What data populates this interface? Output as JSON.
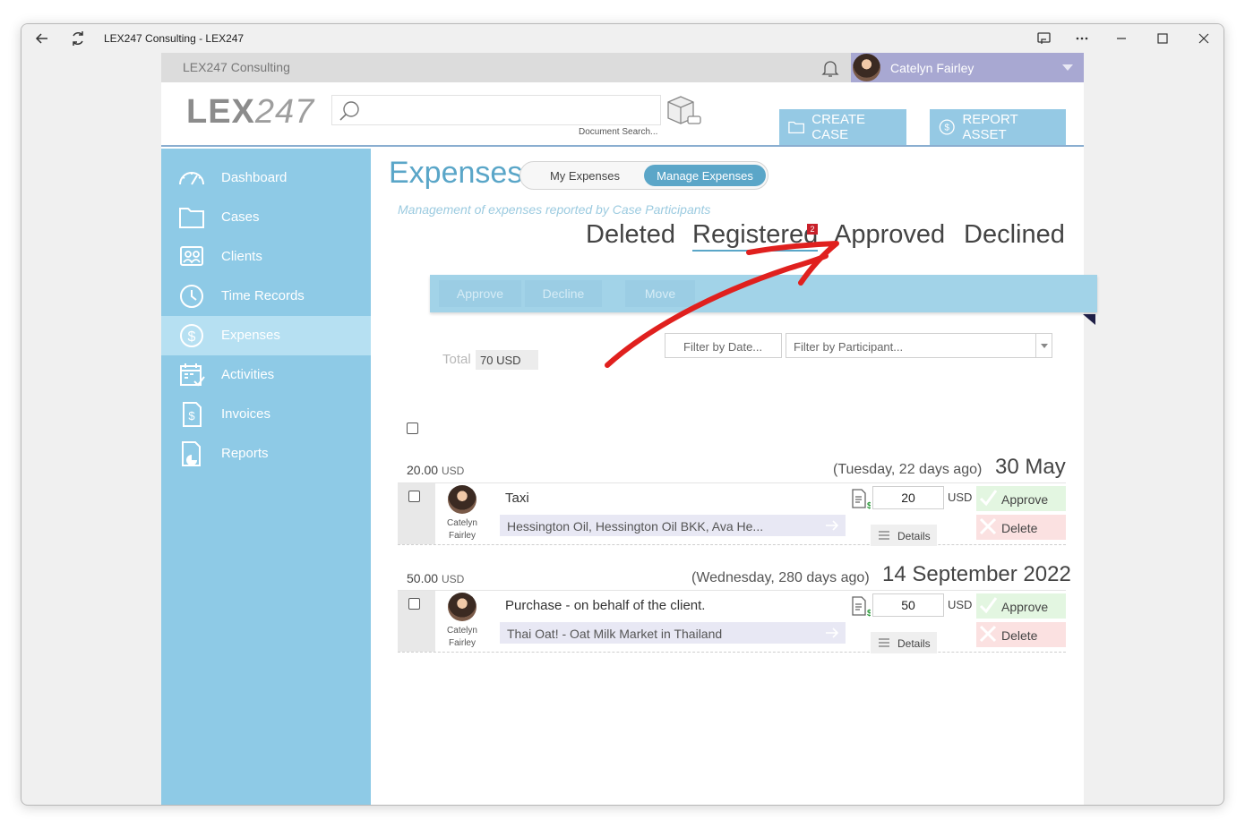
{
  "window": {
    "title": "LEX247 Consulting - LEX247"
  },
  "topbar": {
    "org_name": "LEX247 Consulting",
    "user_name": "Catelyn Fairley"
  },
  "header": {
    "logo_bold": "LEX",
    "logo_light": "247",
    "search_placeholder": "",
    "doc_search_label": "Document Search...",
    "create_case_label": "CREATE CASE",
    "report_asset_label": "REPORT ASSET"
  },
  "sidebar": {
    "items": [
      {
        "label": "Dashboard",
        "icon": "speedometer-icon"
      },
      {
        "label": "Cases",
        "icon": "folder-icon"
      },
      {
        "label": "Clients",
        "icon": "clients-icon"
      },
      {
        "label": "Time Records",
        "icon": "clock-icon"
      },
      {
        "label": "Expenses",
        "icon": "dollar-circle-icon",
        "active": true
      },
      {
        "label": "Activities",
        "icon": "calendar-check-icon"
      },
      {
        "label": "Invoices",
        "icon": "invoice-icon"
      },
      {
        "label": "Reports",
        "icon": "report-icon"
      }
    ]
  },
  "page": {
    "title": "Expenses",
    "toggle": {
      "my": "My Expenses",
      "manage": "Manage Expenses",
      "selected": "Manage Expenses"
    },
    "subtitle": "Management of expenses reported by Case Participants",
    "status_tabs": [
      "Deleted",
      "Registered",
      "Approved",
      "Declined"
    ],
    "active_tab": "Registered",
    "registered_badge": "2",
    "actions": {
      "approve": "Approve",
      "decline": "Decline",
      "move": "Move"
    },
    "filters": {
      "date_placeholder": "Filter by Date...",
      "participant_placeholder": "Filter by Participant..."
    },
    "total_label": "Total",
    "total_value": "70 USD"
  },
  "expense_groups": [
    {
      "amount": "20.00",
      "currency": "USD",
      "relative": "(Tuesday, 22 days ago)",
      "date": "30 May",
      "items": [
        {
          "user_first": "Catelyn",
          "user_last": "Fairley",
          "description": "Taxi",
          "case": "Hessington Oil, Hessington Oil BKK, Ava He...",
          "amount": "20",
          "currency": "USD",
          "details_label": "Details",
          "approve_label": "Approve",
          "delete_label": "Delete"
        }
      ]
    },
    {
      "amount": "50.00",
      "currency": "USD",
      "relative": "(Wednesday, 280 days ago)",
      "date": "14 September 2022",
      "items": [
        {
          "user_first": "Catelyn",
          "user_last": "Fairley",
          "description": "Purchase - on behalf of the client.",
          "case": "Thai Oat! - Oat Milk Market in Thailand",
          "amount": "50",
          "currency": "USD",
          "details_label": "Details",
          "approve_label": "Approve",
          "delete_label": "Delete"
        }
      ]
    }
  ],
  "colors": {
    "sidebar": "#8ecae6",
    "sidebar_active": "#b6e0f2",
    "accent": "#5aa6c8",
    "user_bar": "#a8a8d2",
    "annotation": "#e0201e"
  }
}
